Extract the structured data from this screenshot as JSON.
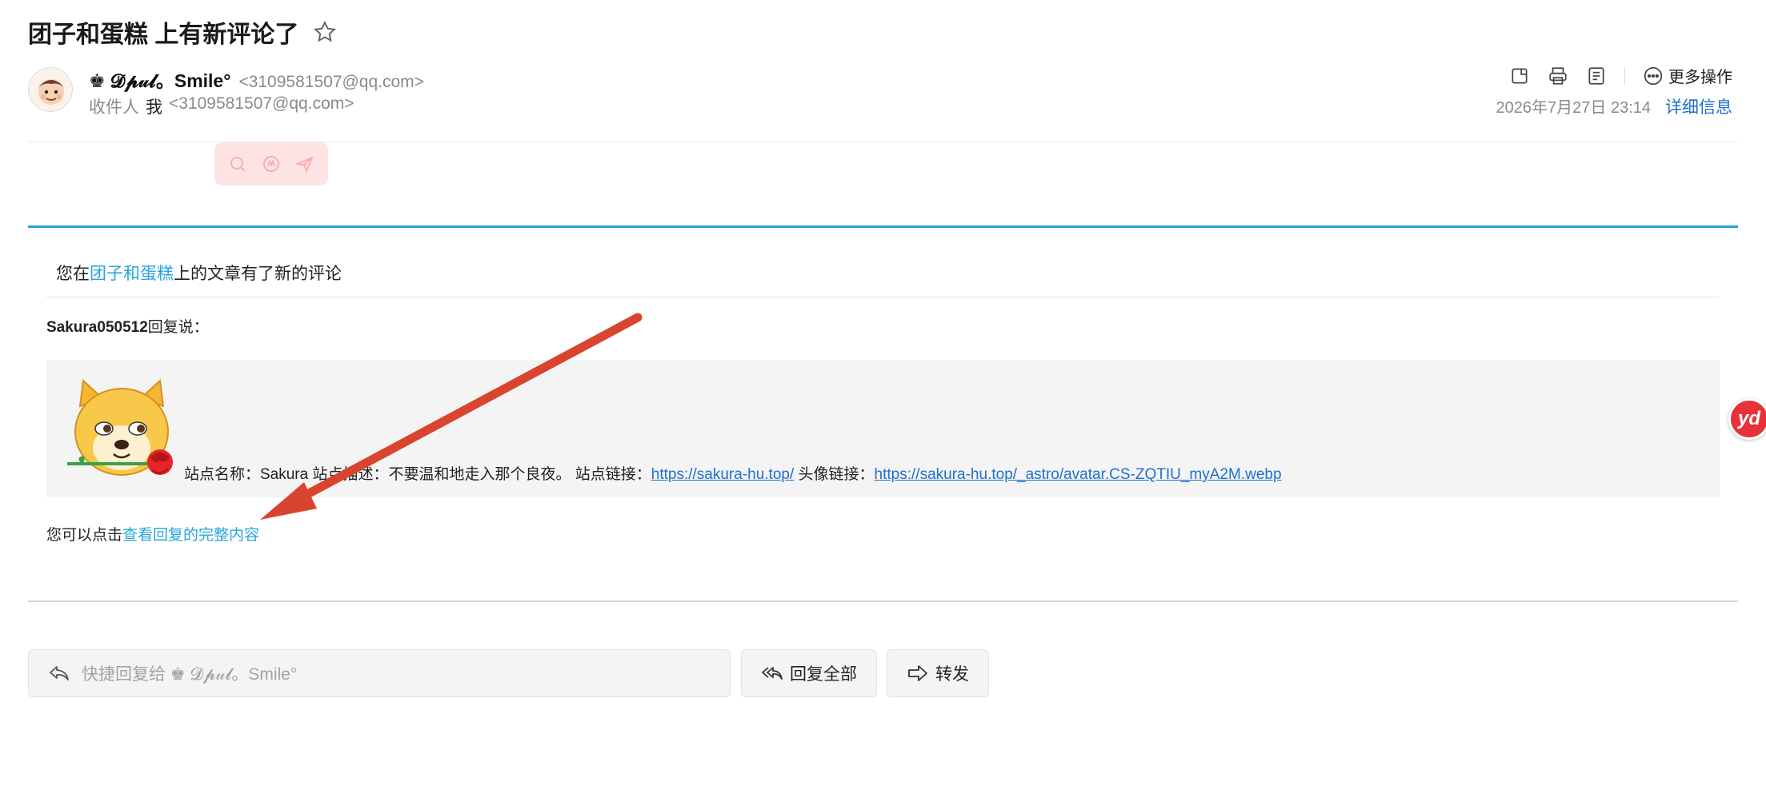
{
  "subject": "团子和蛋糕 上有新评论了",
  "sender": {
    "name": "♚ 𝓓𝓹𝓊𝓵。Smile°",
    "email": "<3109581507@qq.com>"
  },
  "recipient": {
    "label": "收件人",
    "name": "我",
    "email": "<3109581507@qq.com>"
  },
  "actions": {
    "more": "更多操作",
    "details": "详细信息",
    "date": "2026年7月27日 23:14"
  },
  "body": {
    "intro_prefix": "您在",
    "intro_link": "团子和蛋糕",
    "intro_suffix": "上的文章有了新的评论",
    "replier_name": "Sakura050512",
    "replier_suffix": "回复说：",
    "quote_site_name": "站点名称：Sakura 站点描述：不要温和地走入那个良夜。 站点链接：",
    "quote_site_link": "https://sakura-hu.top/",
    "quote_avatar_label": " 头像链接：",
    "quote_avatar_link": "https://sakura-hu.top/_astro/avatar.CS-ZQTIU_myA2M.webp",
    "view_prefix": "您可以点击",
    "view_link": "查看回复的完整内容"
  },
  "quick_reply": {
    "placeholder": "快捷回复给 ♚ 𝓓𝓹𝓊𝓵。Smile°"
  },
  "buttons": {
    "reply_all": "回复全部",
    "forward": "转发"
  },
  "badge": "yd",
  "colors": {
    "accent": "#26a5db",
    "link": "#1f6fd0",
    "arrow": "#d9442e"
  }
}
